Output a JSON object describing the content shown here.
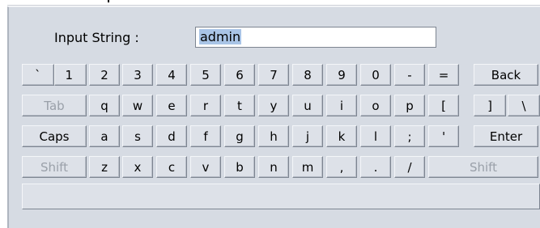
{
  "input": {
    "label": "Input String :",
    "value": "admin"
  },
  "rows": [
    [
      {
        "label": "` ",
        "name": "key-backtick"
      },
      {
        "label": "1",
        "name": "key-1"
      },
      {
        "label": "2",
        "name": "key-2"
      },
      {
        "label": "3",
        "name": "key-3"
      },
      {
        "label": "4",
        "name": "key-4"
      },
      {
        "label": "5",
        "name": "key-5"
      },
      {
        "label": "6",
        "name": "key-6"
      },
      {
        "label": "7",
        "name": "key-7"
      },
      {
        "label": "8",
        "name": "key-8"
      },
      {
        "label": "9",
        "name": "key-9"
      },
      {
        "label": "0",
        "name": "key-0"
      },
      {
        "label": "-",
        "name": "key-minus"
      },
      {
        "label": "=",
        "name": "key-equals"
      },
      {
        "label": "Back",
        "name": "key-backspace"
      }
    ],
    [
      {
        "label": "Tab",
        "name": "key-tab",
        "dim": true
      },
      {
        "label": "q",
        "name": "key-q"
      },
      {
        "label": "w",
        "name": "key-w"
      },
      {
        "label": "e",
        "name": "key-e"
      },
      {
        "label": "r",
        "name": "key-r"
      },
      {
        "label": "t",
        "name": "key-t"
      },
      {
        "label": "y",
        "name": "key-y"
      },
      {
        "label": "u",
        "name": "key-u"
      },
      {
        "label": "i",
        "name": "key-i"
      },
      {
        "label": "o",
        "name": "key-o"
      },
      {
        "label": "p",
        "name": "key-p"
      },
      {
        "label": "[",
        "name": "key-left-bracket"
      },
      {
        "label": "]",
        "name": "key-right-bracket"
      },
      {
        "label": "\\",
        "name": "key-backslash"
      }
    ],
    [
      {
        "label": "Caps",
        "name": "key-caps-lock"
      },
      {
        "label": "a",
        "name": "key-a"
      },
      {
        "label": "s",
        "name": "key-s"
      },
      {
        "label": "d",
        "name": "key-d"
      },
      {
        "label": "f",
        "name": "key-f"
      },
      {
        "label": "g",
        "name": "key-g"
      },
      {
        "label": "h",
        "name": "key-h"
      },
      {
        "label": "j",
        "name": "key-j"
      },
      {
        "label": "k",
        "name": "key-k"
      },
      {
        "label": "l",
        "name": "key-l"
      },
      {
        "label": ";",
        "name": "key-semicolon"
      },
      {
        "label": "'",
        "name": "key-quote"
      },
      {
        "label": "Enter",
        "name": "key-enter"
      }
    ],
    [
      {
        "label": "Shift",
        "name": "key-shift-left",
        "dim": true
      },
      {
        "label": "z",
        "name": "key-z"
      },
      {
        "label": "x",
        "name": "key-x"
      },
      {
        "label": "c",
        "name": "key-c"
      },
      {
        "label": "v",
        "name": "key-v"
      },
      {
        "label": "b",
        "name": "key-b"
      },
      {
        "label": "n",
        "name": "key-n"
      },
      {
        "label": "m",
        "name": "key-m"
      },
      {
        "label": ",",
        "name": "key-comma"
      },
      {
        "label": ".",
        "name": "key-period"
      },
      {
        "label": "/",
        "name": "key-slash"
      },
      {
        "label": "Shift",
        "name": "key-shift-right",
        "dim": true
      }
    ]
  ]
}
